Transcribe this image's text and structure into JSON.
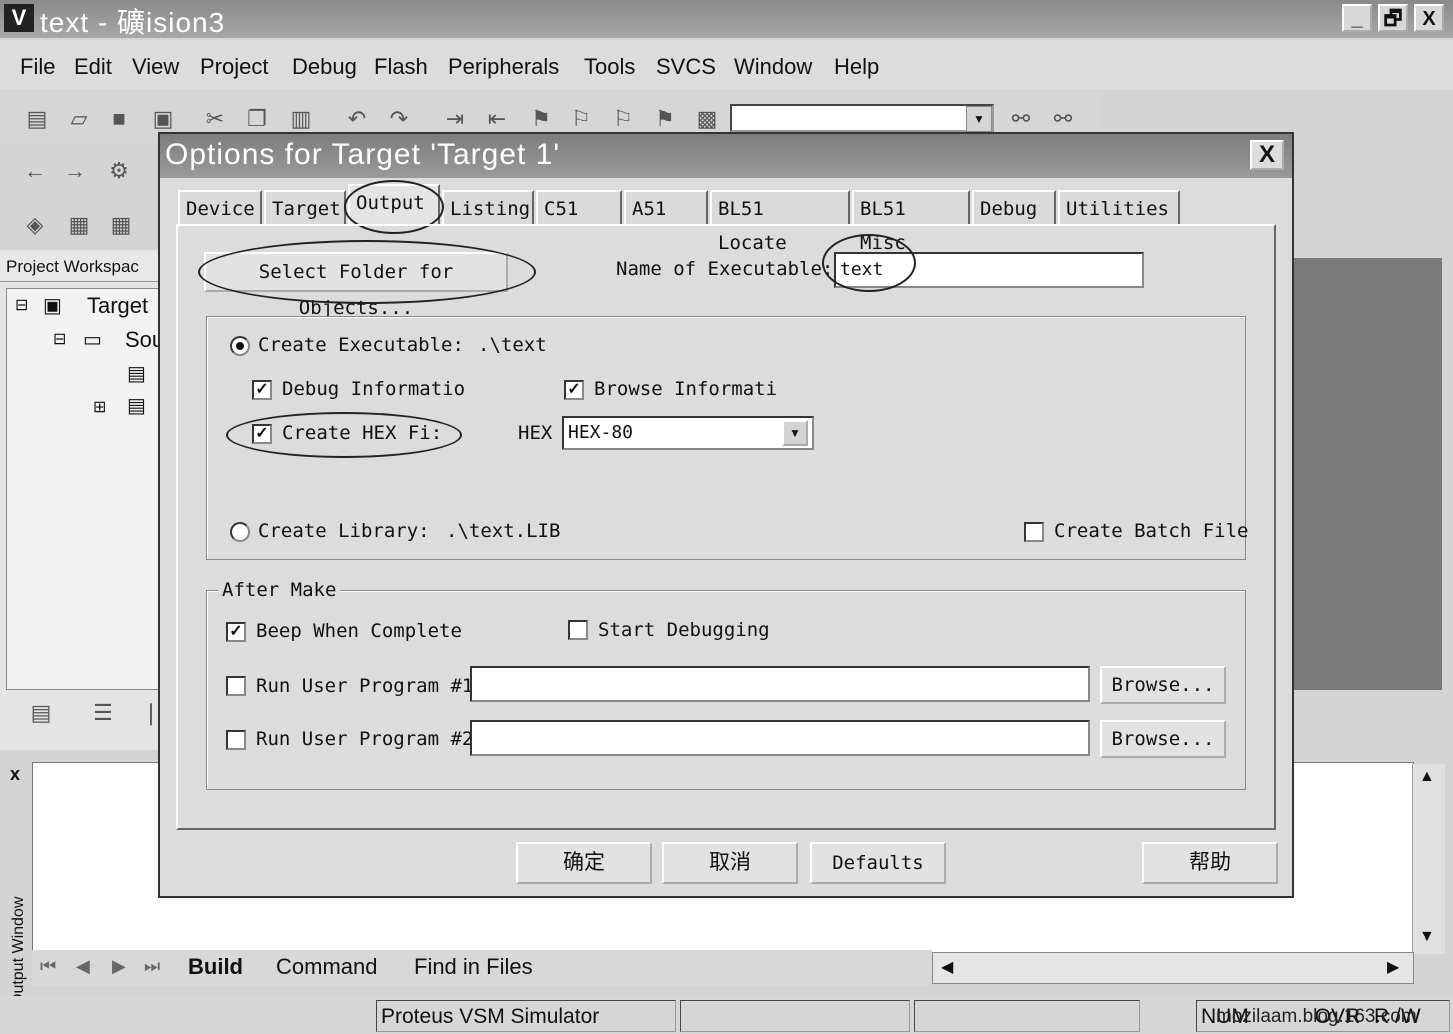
{
  "window": {
    "title": "text  - 礦ision3",
    "icon_letter": "V",
    "min": "_",
    "max": "🗗",
    "close": "X"
  },
  "menu": [
    "File",
    "Edit",
    "View",
    "Project",
    "Debug",
    "Flash",
    "Peripherals",
    "Tools",
    "SVCS",
    "Window",
    "Help"
  ],
  "left_panel": {
    "header": "Project Workspac",
    "tree": [
      {
        "expander": "⊟",
        "label": "Target"
      },
      {
        "expander": "⊟",
        "label": "Sou"
      },
      {
        "expander": "",
        "label": ""
      },
      {
        "expander": "⊞",
        "label": ""
      }
    ]
  },
  "dialog": {
    "title": "Options for Target 'Target 1'",
    "close": "X",
    "tabs": [
      "Device",
      "Target",
      "Output",
      "Listing",
      "C51",
      "A51",
      "BL51 Locate",
      "BL51 Misc",
      "Debug",
      "Utilities"
    ],
    "active_tab": "Output",
    "select_folder_button": "Select Folder for Objects...",
    "name_of_executable_label": "Name of Executable:",
    "name_of_executable_value": "text",
    "create_executable_label": "Create Executable:",
    "create_executable_path": ".\\text",
    "debug_info_label": "Debug Informatio",
    "browse_info_label": "Browse Informati",
    "create_hex_label": "Create HEX Fi:",
    "hex_label": "HEX",
    "hex_format_value": "HEX-80",
    "create_library_label": "Create Library:",
    "create_library_path": ".\\text.LIB",
    "create_batch_label": "Create Batch File",
    "after_make_label": "After Make",
    "beep_label": "Beep When Complete",
    "start_debug_label": "Start Debugging",
    "run1_label": "Run User Program #1",
    "run2_label": "Run User Program #2",
    "browse1": "Browse...",
    "browse2": "Browse...",
    "ok": "确定",
    "cancel": "取消",
    "defaults": "Defaults",
    "help": "帮助",
    "checks": {
      "debug_info": true,
      "browse_info": true,
      "create_hex": true,
      "beep": true,
      "start_debug": false,
      "run1": false,
      "run2": false,
      "batch": false
    },
    "radio_selected": "create_executable"
  },
  "output": {
    "side_label": "Output Window",
    "close": "x",
    "tabs": [
      "Build",
      "Command",
      "Find in Files"
    ]
  },
  "status": {
    "sim": "Proteus VSM Simulator",
    "watermark": "mozilaam.blog.163.com",
    "num": "NUM",
    "ovr": "OVR",
    "rw": "R /W"
  }
}
